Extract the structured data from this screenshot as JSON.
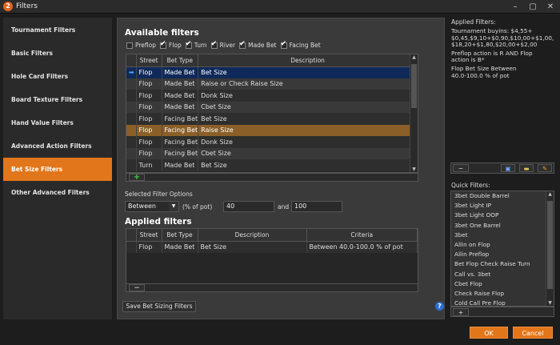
{
  "window": {
    "title": "Filters",
    "app_icon_letter": "2"
  },
  "sidebar": {
    "items": [
      {
        "label": "Tournament Filters"
      },
      {
        "label": "Basic Filters"
      },
      {
        "label": "Hole Card Filters"
      },
      {
        "label": "Board Texture Filters"
      },
      {
        "label": "Hand Value Filters"
      },
      {
        "label": "Advanced Action Filters"
      },
      {
        "label": "Bet Size Filters"
      },
      {
        "label": "Other Advanced Filters"
      }
    ]
  },
  "available": {
    "heading": "Available filters",
    "checkboxes": [
      {
        "label": "Preflop",
        "checked": false
      },
      {
        "label": "Flop",
        "checked": true
      },
      {
        "label": "Turn",
        "checked": true
      },
      {
        "label": "River",
        "checked": true
      },
      {
        "label": "Made Bet",
        "checked": true
      },
      {
        "label": "Facing Bet",
        "checked": true
      }
    ],
    "columns": [
      "Street",
      "Bet Type",
      "Description"
    ],
    "rows": [
      [
        "Flop",
        "Made Bet",
        "Bet Size"
      ],
      [
        "Flop",
        "Made Bet",
        "Raise or Check Raise Size"
      ],
      [
        "Flop",
        "Made Bet",
        "Donk Size"
      ],
      [
        "Flop",
        "Made Bet",
        "Cbet Size"
      ],
      [
        "Flop",
        "Facing Bet",
        "Bet Size"
      ],
      [
        "Flop",
        "Facing Bet",
        "Raise Size"
      ],
      [
        "Flop",
        "Facing Bet",
        "Donk Size"
      ],
      [
        "Flop",
        "Facing Bet",
        "Cbet Size"
      ],
      [
        "Turn",
        "Made Bet",
        "Bet Size"
      ]
    ],
    "add_button": "+"
  },
  "options": {
    "label": "Selected Filter Options",
    "mode": "Between",
    "unit": "(% of pot)",
    "low": "40",
    "and": "and",
    "high": "100"
  },
  "applied": {
    "heading": "Applied filters",
    "columns": [
      "Street",
      "Bet Type",
      "Description",
      "Criteria"
    ],
    "rows": [
      [
        "Flop",
        "Made Bet",
        "Bet Size",
        "Between 40.0-100.0 % of pot"
      ]
    ],
    "remove_button": "−",
    "save_button": "Save Bet Sizing Filters"
  },
  "applied_summary": {
    "heading": "Applied Filters:",
    "lines": [
      "Tournament buyins: $4,55+",
      "$0,45,$9,10+$0,90,$10,00+$1,00,",
      "$18,20+$1,80,$20,00+$2,00",
      "Preflop action is R AND Flop",
      "action is B*",
      "Flop Bet Size Between",
      "40.0-100.0 % of pot"
    ]
  },
  "quick": {
    "heading": "Quick Filters:",
    "items": [
      "3bet Double Barrel",
      "3bet Light IP",
      "3bet Light OOP",
      "3bet One Barrel",
      "3bet",
      "Allin on Flop",
      "Allin Preflop",
      "Bet Flop Check Raise Turn",
      "Call vs. 3bet",
      "Cbet Flop",
      "Check Raise Flop",
      "Cold Call Pre Flop"
    ],
    "add_button": "+"
  },
  "help": "?",
  "footer": {
    "ok": "OK",
    "cancel": "Cancel"
  },
  "colors": {
    "accent": "#e2761b",
    "selected_row": "#0f2a5a",
    "highlight_row": "#8a5f28"
  }
}
